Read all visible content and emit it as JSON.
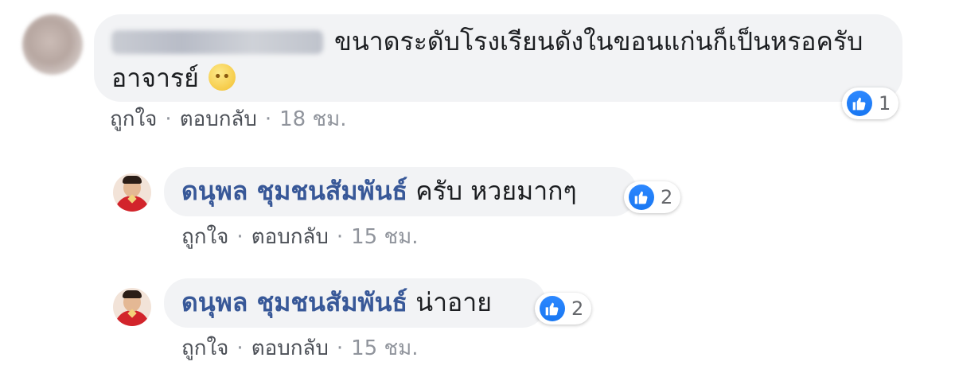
{
  "main_comment": {
    "text_line1": "ขนาดระดับโรงเรียนดังในขอนแก่นก็เป็นหรอครับ",
    "text_line2": "อาจารย์",
    "emoji_icon": "pensive-face-icon",
    "reaction_count": "1",
    "actions": {
      "like": "ถูกใจ",
      "reply": "ตอบกลับ",
      "time": "18 ชม."
    }
  },
  "replies": [
    {
      "author": "ดนุพล ชุมชนสัมพันธ์",
      "text": "ครับ หวยมากๆ",
      "reaction_count": "2",
      "actions": {
        "like": "ถูกใจ",
        "reply": "ตอบกลับ",
        "time": "15 ชม."
      }
    },
    {
      "author": "ดนุพล ชุมชนสัมพันธ์",
      "text": "น่าอาย",
      "reaction_count": "2",
      "actions": {
        "like": "ถูกใจ",
        "reply": "ตอบกลับ",
        "time": "15 ชม."
      }
    }
  ],
  "colors": {
    "bubble": "#f2f3f5",
    "author_link": "#385898",
    "like_blue": "#1877f2",
    "meta_gray": "#90949c"
  }
}
